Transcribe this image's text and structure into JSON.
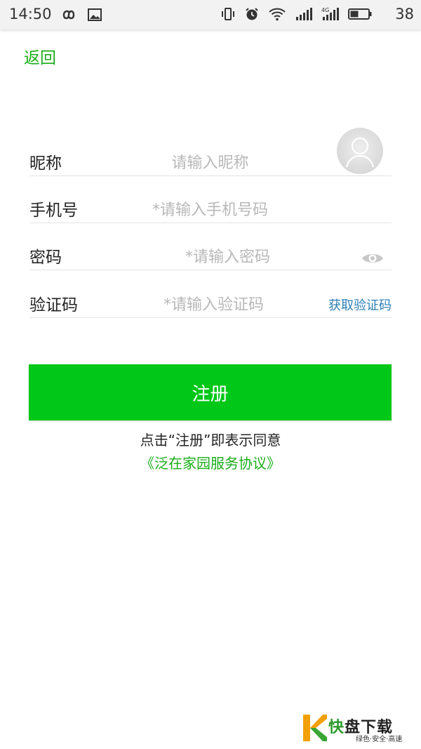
{
  "status_bar": {
    "time": "14:50",
    "battery_percent": "38",
    "icons": [
      "infinity-icon",
      "image-icon",
      "vibrate-icon",
      "alarm-icon",
      "wifi-icon",
      "signal-icon",
      "signal-4g-icon",
      "battery-icon"
    ]
  },
  "header": {
    "back_label": "返回"
  },
  "form": {
    "nickname": {
      "label": "昵称",
      "placeholder": "请输入昵称"
    },
    "phone": {
      "label": "手机号",
      "placeholder": "*请输入手机号码"
    },
    "password": {
      "label": "密码",
      "placeholder": "*请输入密码"
    },
    "code": {
      "label": "验证码",
      "placeholder": "*请输入验证码",
      "get_code_label": "获取验证码"
    }
  },
  "register_button": {
    "label": "注册"
  },
  "agreement": {
    "text": "点击“注册”即表示同意",
    "link": "《泛在家园服务协议》"
  },
  "watermark": {
    "title_first": "快",
    "title_rest": "盘下载",
    "subtitle": "绿色·安全·高速"
  },
  "colors": {
    "accent_green": "#00c718",
    "link_green": "#1aad19",
    "link_blue": "#2a7fb5"
  }
}
